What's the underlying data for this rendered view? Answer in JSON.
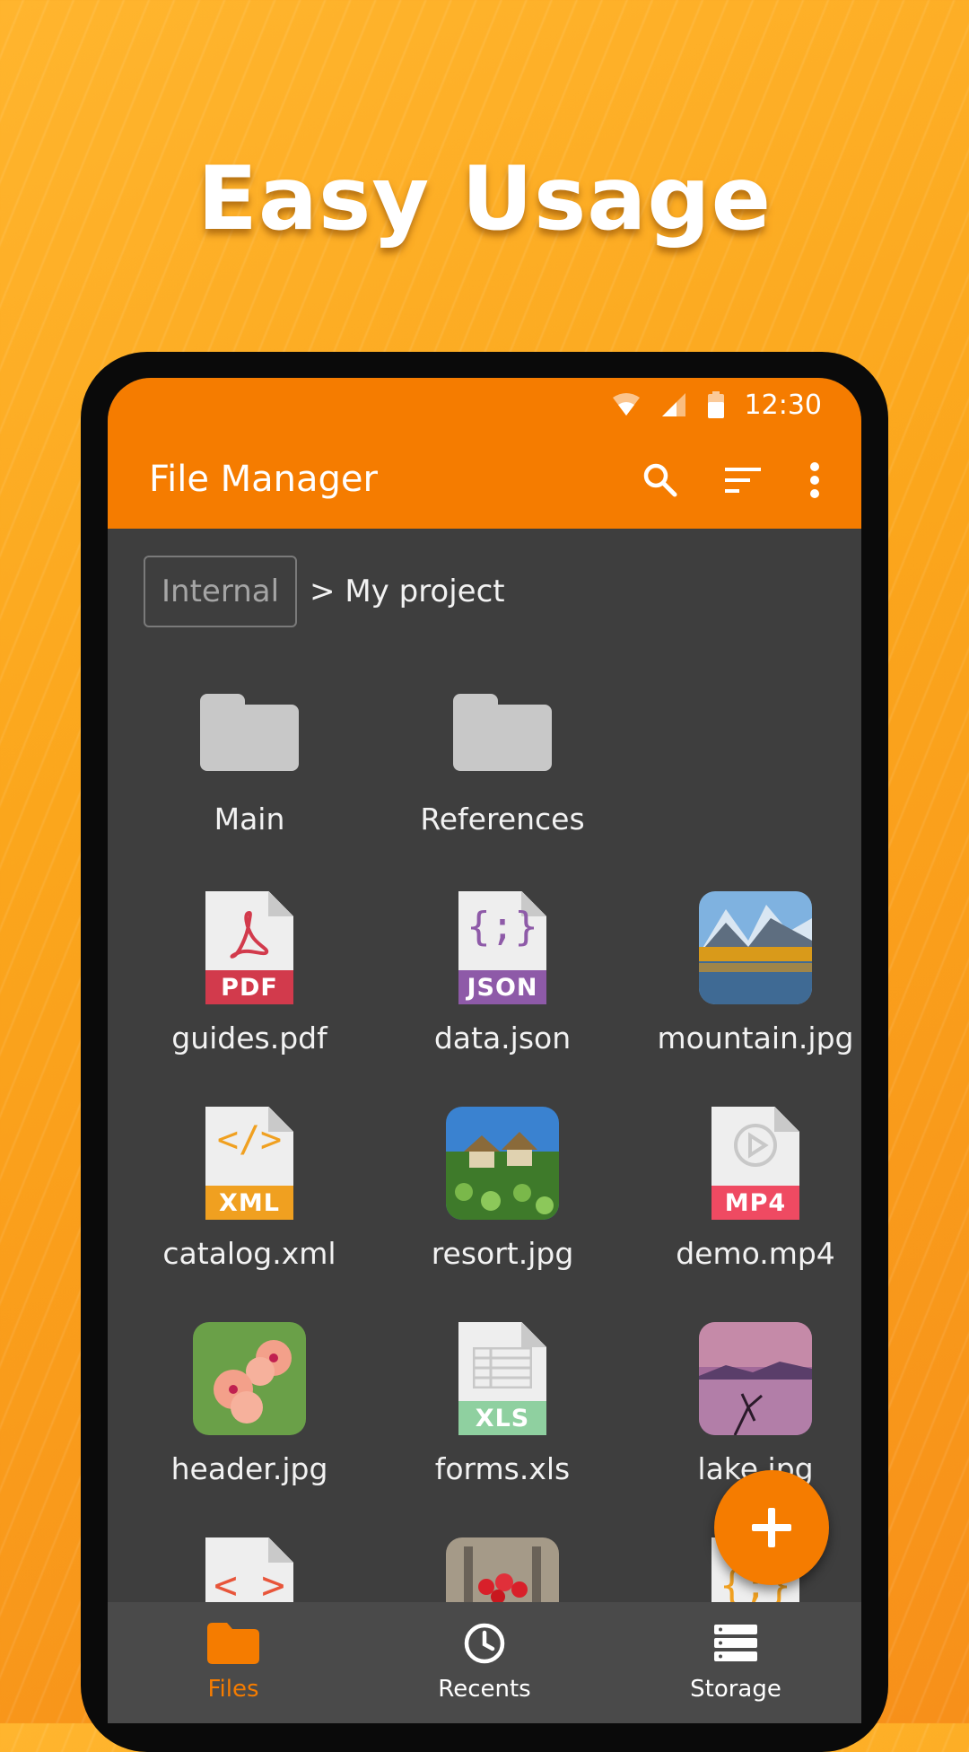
{
  "headline": "Easy Usage",
  "status": {
    "time": "12:30"
  },
  "appbar": {
    "title": "File Manager"
  },
  "breadcrumb": {
    "root": "Internal",
    "path": "> My project"
  },
  "items": [
    {
      "name": "Main",
      "kind": "folder"
    },
    {
      "name": "References",
      "kind": "folder"
    },
    {
      "name": "guides.pdf",
      "kind": "doc",
      "badge": "PDF",
      "color": "#d23a4c"
    },
    {
      "name": "data.json",
      "kind": "doc",
      "badge": "JSON",
      "color": "#8e5aa8"
    },
    {
      "name": "mountain.jpg",
      "kind": "photo"
    },
    {
      "name": "catalog.xml",
      "kind": "doc",
      "badge": "XML",
      "color": "#f0a020"
    },
    {
      "name": "resort.jpg",
      "kind": "photo"
    },
    {
      "name": "demo.mp4",
      "kind": "doc",
      "badge": "MP4",
      "color": "#ef4a62"
    },
    {
      "name": "header.jpg",
      "kind": "photo"
    },
    {
      "name": "forms.xls",
      "kind": "doc",
      "badge": "XLS",
      "color": "#8fd0a0"
    },
    {
      "name": "lake.jpg",
      "kind": "photo"
    }
  ],
  "nav": [
    {
      "label": "Files",
      "active": true
    },
    {
      "label": "Recents",
      "active": false
    },
    {
      "label": "Storage",
      "active": false
    }
  ],
  "colors": {
    "accent": "#f57c00",
    "background": "#3e3e3e"
  },
  "icons": [
    "search-icon",
    "sort-icon",
    "more-vert-icon",
    "add-icon",
    "folder-icon",
    "clock-icon",
    "storage-icon"
  ]
}
